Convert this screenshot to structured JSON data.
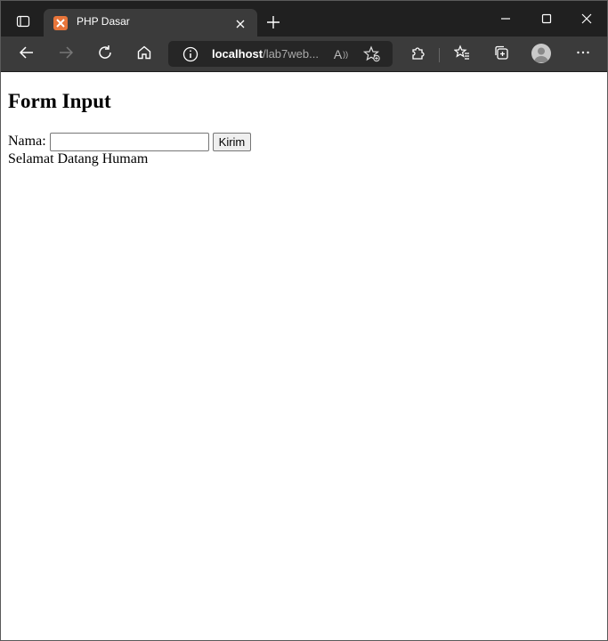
{
  "browser": {
    "tab": {
      "title": "PHP Dasar",
      "favicon": "xampp-icon"
    },
    "address": {
      "host": "localhost",
      "path": "/lab7web",
      "ellipsis": "..."
    },
    "read_aloud_label": "A",
    "colors": {
      "titlebar": "#202020",
      "toolbar": "#3b3b3b",
      "favicon": "#e8753a"
    }
  },
  "page": {
    "heading": "Form Input",
    "form": {
      "label": "Nama:",
      "input_value": "",
      "submit_label": "Kirim"
    },
    "message": "Selamat Datang Humam"
  }
}
